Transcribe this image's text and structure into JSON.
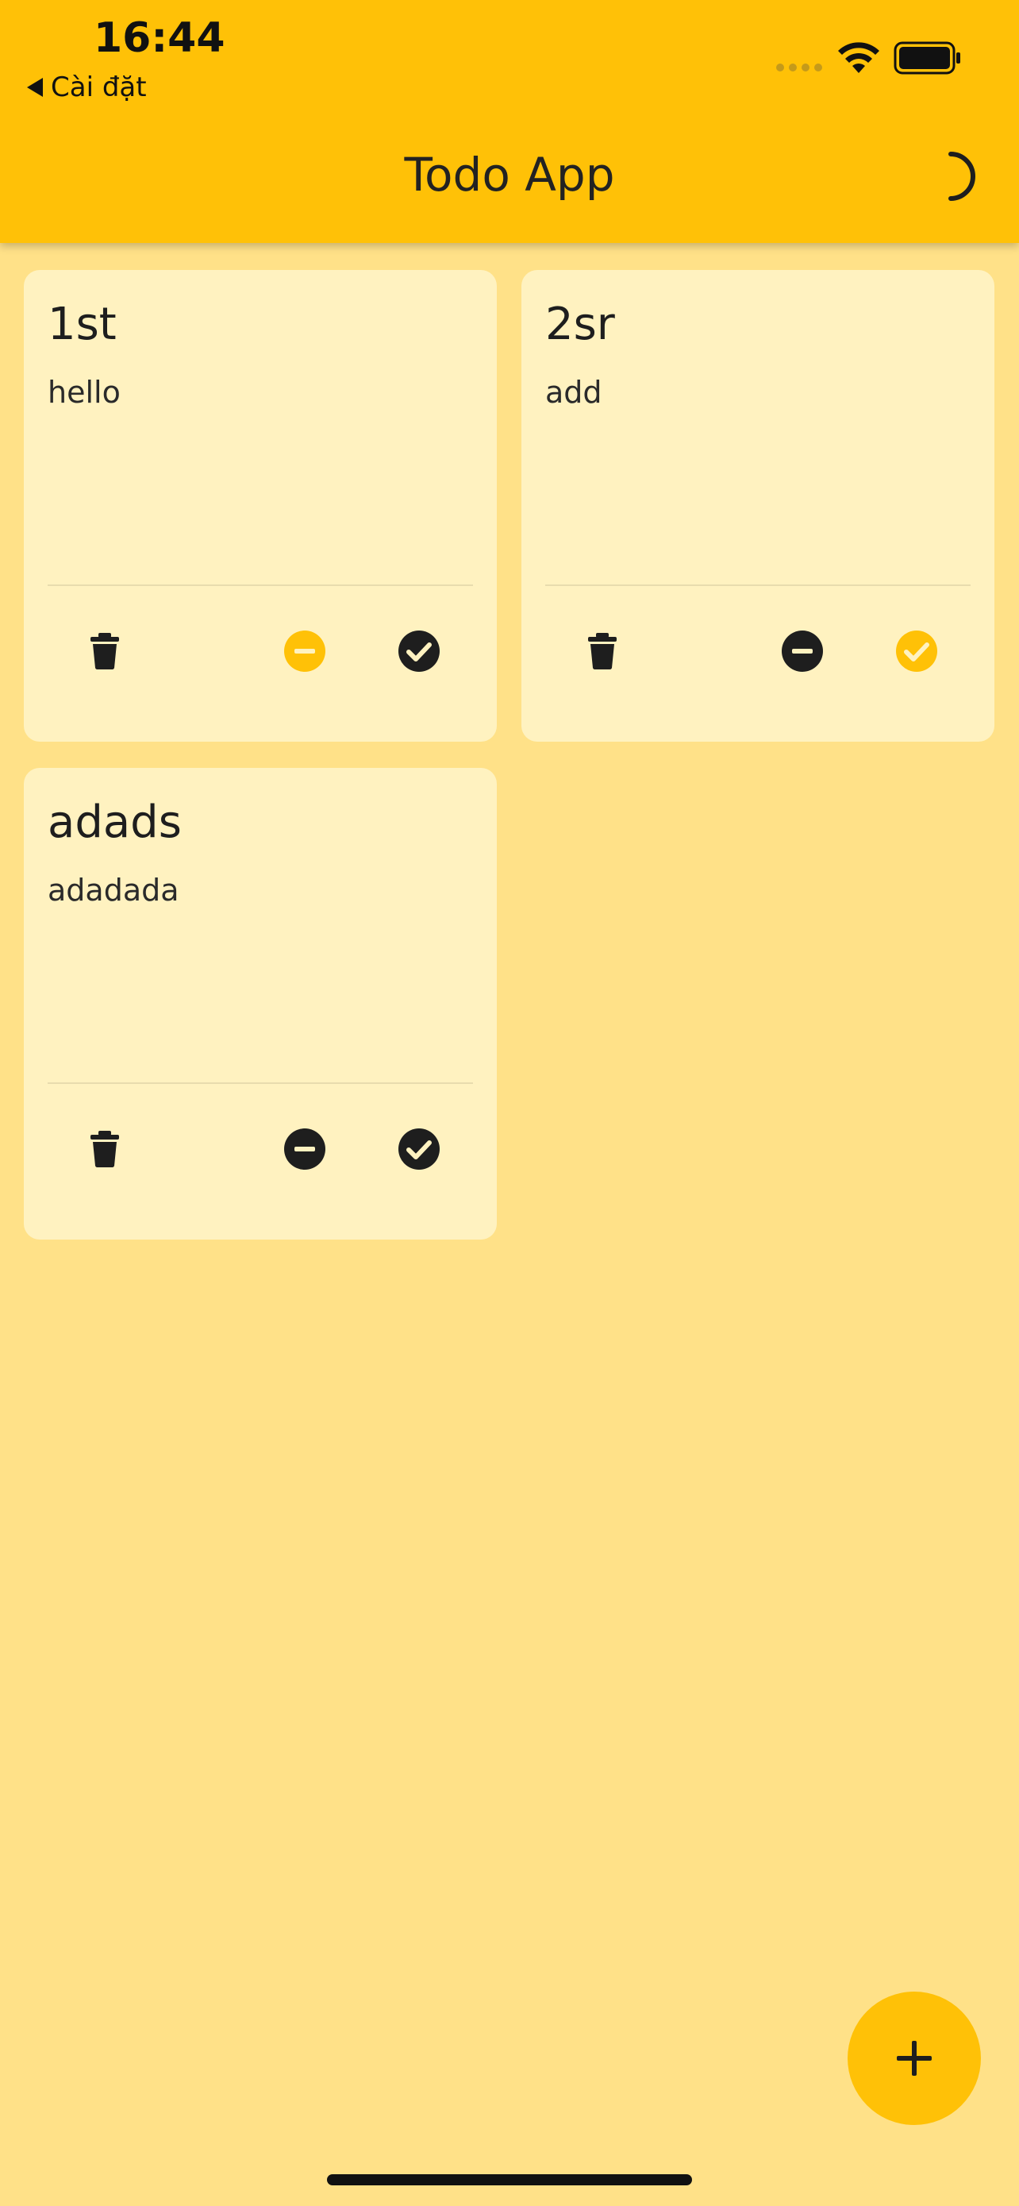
{
  "status_bar": {
    "time": "16:44",
    "back_label": "Cài đặt"
  },
  "app_bar": {
    "title": "Todo App",
    "theme_icon": "moon-icon"
  },
  "colors": {
    "accent": "#FFC107",
    "background": "#FFE188",
    "card": "#FFF2C0",
    "icon_dark": "#1e1e1e"
  },
  "todos": [
    {
      "title": "1st",
      "description": "hello",
      "active_status": "in-progress"
    },
    {
      "title": "2sr",
      "description": "add",
      "active_status": "done"
    },
    {
      "title": "adads",
      "description": "adadada",
      "active_status": "none"
    }
  ],
  "fab": {
    "icon": "plus-icon"
  }
}
